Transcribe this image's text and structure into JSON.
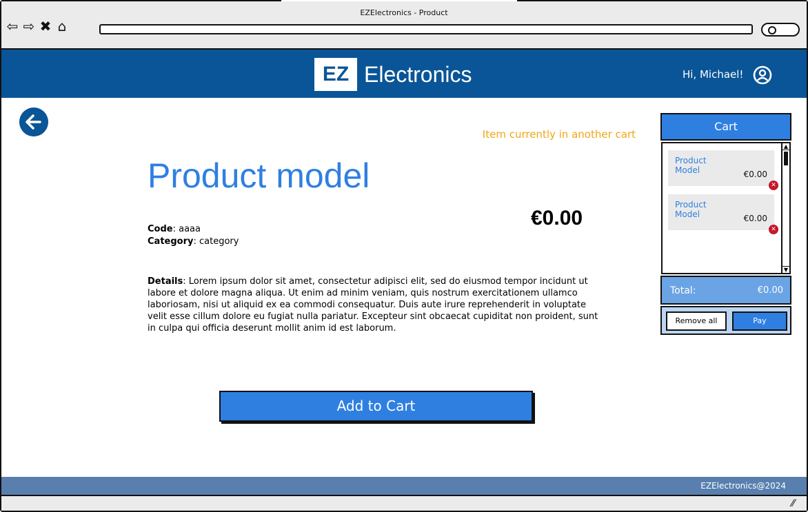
{
  "window": {
    "title": "EZElectronics - Product"
  },
  "header": {
    "logo_mark": "EZ",
    "logo_text": "Electronics",
    "greeting": "Hi, Michael!"
  },
  "product": {
    "notice": "Item currently in another cart",
    "title": "Product model",
    "price": "€0.00",
    "code_label": "Code",
    "code_value": ": aaaa",
    "category_label": "Category",
    "category_value": ": category",
    "details_label": "Details",
    "details_value": ": Lorem ipsum dolor sit amet, consectetur adipisci elit, sed do eiusmod tempor incidunt ut labore et dolore magna aliqua. Ut enim ad minim veniam, quis nostrum exercitationem ullamco laboriosam, nisi ut aliquid ex ea commodi consequatur. Duis aute irure reprehenderit in voluptate velit esse cillum dolore eu fugiat nulla pariatur. Excepteur sint obcaecat cupiditat non proident, sunt in culpa qui officia deserunt mollit anim id est laborum.",
    "add_button": "Add to Cart"
  },
  "cart": {
    "title": "Cart",
    "items": [
      {
        "name": "Product Model",
        "price": "€0.00"
      },
      {
        "name": "Product Model",
        "price": "€0.00"
      }
    ],
    "total_label": "Total:",
    "total_value": "€0.00",
    "remove_all": "Remove all",
    "pay": "Pay"
  },
  "footer": {
    "text": "EZElectronics@2024"
  },
  "icons": {
    "back": "arrow-left-icon",
    "user": "user-circle-icon",
    "remove_item": "close-icon"
  },
  "colors": {
    "header_bg": "#0a5597",
    "accent": "#2f7fe1",
    "notice": "#f0a516",
    "footer_bg": "#587fae",
    "remove": "#c6162b"
  }
}
